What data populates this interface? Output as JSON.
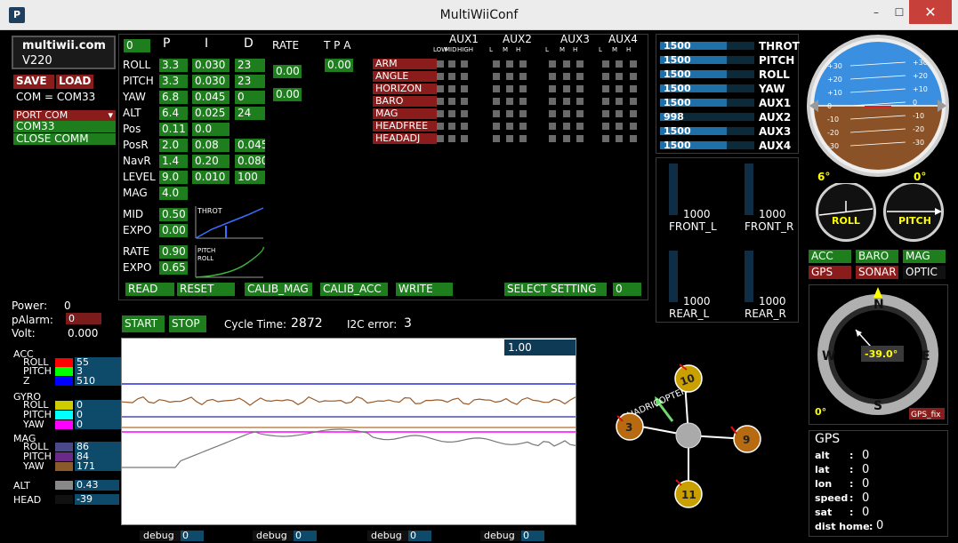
{
  "window": {
    "title": "MultiWiiConf",
    "app_icon": "P",
    "minimize_glyph": "–",
    "maximize_glyph": "☐",
    "close_glyph": "✕"
  },
  "header": {
    "brand": "multiwii.com",
    "version": "V220"
  },
  "conn": {
    "save": "SAVE",
    "load": "LOAD",
    "com_label": "COM = COM33",
    "port_com": "PORT COM",
    "port_item": "COM33",
    "close": "CLOSE COMM"
  },
  "pid": {
    "top_value": "0",
    "headers": {
      "p": "P",
      "i": "I",
      "d": "D",
      "rate": "RATE",
      "tpa": "T P A"
    },
    "rows": [
      {
        "name": "ROLL",
        "p": "3.3",
        "i": "0.030",
        "d": "23",
        "rate": "0.00",
        "tpa": "0.00"
      },
      {
        "name": "PITCH",
        "p": "3.3",
        "i": "0.030",
        "d": "23"
      },
      {
        "name": "YAW",
        "p": "6.8",
        "i": "0.045",
        "d": "0",
        "rate": "0.00"
      },
      {
        "name": "ALT",
        "p": "6.4",
        "i": "0.025",
        "d": "24"
      },
      {
        "name": "Pos",
        "p": "0.11",
        "i": "0.0"
      },
      {
        "name": "PosR",
        "p": "2.0",
        "i": "0.08",
        "d": "0.045"
      },
      {
        "name": "NavR",
        "p": "1.4",
        "i": "0.20",
        "d": "0.080"
      },
      {
        "name": "LEVEL",
        "p": "9.0",
        "i": "0.010",
        "d": "100"
      },
      {
        "name": "MAG",
        "p": "4.0"
      }
    ],
    "throt": {
      "mid_label": "MID",
      "mid": "0.50",
      "expo_label": "EXPO",
      "expo": "0.00",
      "curve_label": "THROT"
    },
    "rate": {
      "rate_label": "RATE",
      "rate": "0.90",
      "expo_label": "EXPO",
      "expo": "0.65",
      "curve_label1": "PITCH",
      "curve_label2": "ROLL"
    }
  },
  "actions": {
    "read": "READ",
    "reset": "RESET",
    "calib_mag": "CALIB_MAG",
    "calib_acc": "CALIB_ACC",
    "write": "WRITE",
    "select_setting": "SELECT SETTING",
    "setting_value": "0"
  },
  "aux": {
    "groups": [
      "AUX1",
      "AUX2",
      "AUX3",
      "AUX4"
    ],
    "sub_first": [
      "LOW",
      "MID",
      "HIGH"
    ],
    "sub": [
      "L",
      "M",
      "H"
    ],
    "modes": [
      "ARM",
      "ANGLE",
      "HORIZON",
      "BARO",
      "MAG",
      "HEADFREE",
      "HEADADJ"
    ]
  },
  "rc": {
    "channels": [
      {
        "value": "1500",
        "name": "THROT",
        "fraction": 0.5
      },
      {
        "value": "1500",
        "name": "PITCH",
        "fraction": 0.5
      },
      {
        "value": "1500",
        "name": "ROLL",
        "fraction": 0.5
      },
      {
        "value": "1500",
        "name": "YAW",
        "fraction": 0.5
      },
      {
        "value": "1500",
        "name": "AUX1",
        "fraction": 0.5
      },
      {
        "value": "998",
        "name": "AUX2",
        "fraction": 0.0
      },
      {
        "value": "1500",
        "name": "AUX3",
        "fraction": 0.5
      },
      {
        "value": "1500",
        "name": "AUX4",
        "fraction": 0.5
      }
    ]
  },
  "motors": [
    {
      "value": "1000",
      "name": "FRONT_L",
      "fraction": 0.0
    },
    {
      "value": "1000",
      "name": "FRONT_R",
      "fraction": 0.0
    },
    {
      "value": "1000",
      "name": "REAR_L",
      "fraction": 0.0
    },
    {
      "value": "1000",
      "name": "REAR_R",
      "fraction": 0.0
    }
  ],
  "horizon": {
    "left_ticks": [
      "+30",
      "+20",
      "+10",
      "0",
      "-10",
      "-20",
      "-30"
    ],
    "right_ticks": [
      "+30",
      "+20",
      "+10",
      "0",
      "-10",
      "-20",
      "-30"
    ]
  },
  "angles": {
    "roll_value": "6°",
    "pitch_value": "0°",
    "roll_label": "ROLL",
    "pitch_label": "PITCH"
  },
  "sensors": {
    "acc": "ACC",
    "baro": "BARO",
    "mag": "MAG",
    "gps": "GPS",
    "sonar": "SONAR",
    "optic": "OPTIC"
  },
  "compass": {
    "n": "N",
    "s": "S",
    "e": "E",
    "w": "W",
    "heading": "-39.0°",
    "zero": "0°",
    "gps_fix": "GPS_fix"
  },
  "power": {
    "power_label": "Power:",
    "power": "0",
    "palarm_label": "pAlarm:",
    "palarm": "0",
    "volt_label": "Volt:",
    "volt": "0.000"
  },
  "control": {
    "start": "START",
    "stop": "STOP",
    "cycle_label": "Cycle Time:",
    "cycle": "2872",
    "i2c_label": "I2C error:",
    "i2c": "3"
  },
  "graph": {
    "scale": "1.00"
  },
  "sensor_values": {
    "acc": {
      "label": "ACC",
      "roll": "55",
      "pitch": "3",
      "z": "510"
    },
    "gyro": {
      "label": "GYRO",
      "roll": "0",
      "pitch": "0",
      "yaw": "0"
    },
    "mag": {
      "label": "MAG",
      "roll": "86",
      "pitch": "84",
      "yaw": "171"
    },
    "alt": {
      "label": "ALT",
      "value": "0.43"
    },
    "head": {
      "label": "HEAD",
      "value": "-39"
    },
    "roll_label": "ROLL",
    "pitch_label": "PITCH",
    "z_label": "Z",
    "yaw_label": "YAW",
    "colors": {
      "roll": "#ff0000",
      "pitch": "#00ff00",
      "z": "#0000ff",
      "groll": "#cccc00",
      "gpitch": "#00ffff",
      "gyaw": "#ff00ff",
      "mroll": "#4a4a8a",
      "mpitch": "#6a2a8a",
      "myaw": "#8a5a2a"
    }
  },
  "quad": {
    "label": "QUADRICOPTER X",
    "motors": [
      "10",
      "9",
      "11",
      "3"
    ]
  },
  "gps": {
    "title": "GPS",
    "alt_label": "alt",
    "alt": "0",
    "lat_label": "lat",
    "lat": "0",
    "lon_label": "lon",
    "lon": "0",
    "speed_label": "speed",
    "speed": "0",
    "sat_label": "sat",
    "sat": "0",
    "dist_label": "dist home",
    "dist": "0"
  },
  "debug": [
    {
      "label": "debug",
      "value": "0"
    },
    {
      "label": "debug",
      "value": "0"
    },
    {
      "label": "debug",
      "value": "0"
    },
    {
      "label": "debug",
      "value": "0"
    }
  ]
}
